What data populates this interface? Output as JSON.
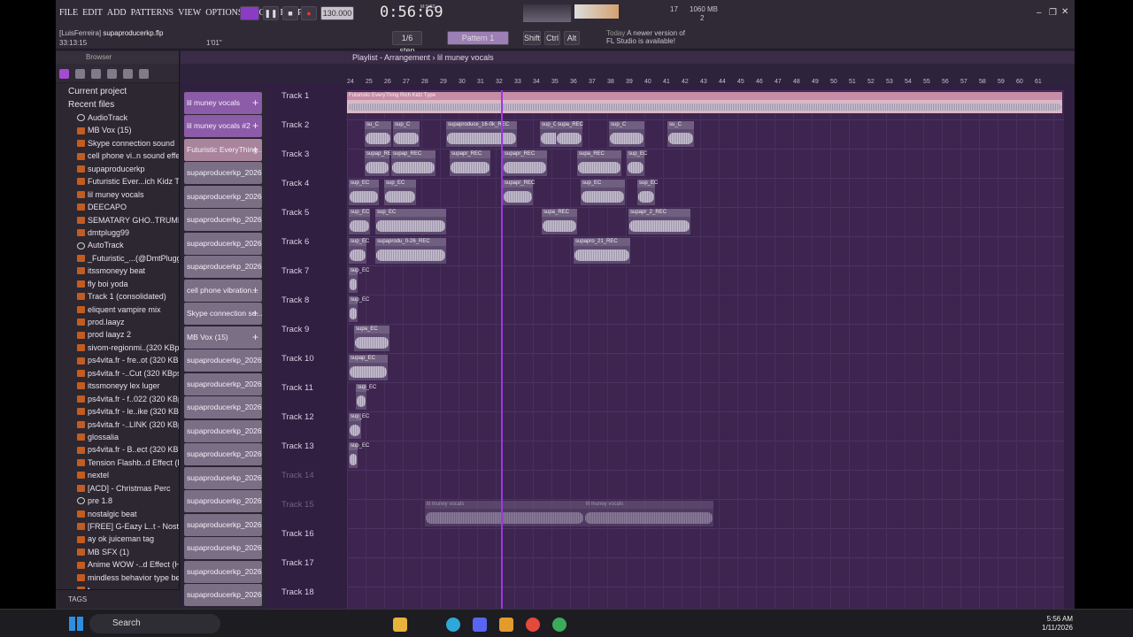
{
  "menu": [
    "FILE",
    "EDIT",
    "ADD",
    "PATTERNS",
    "VIEW",
    "OPTIONS",
    "TOOLS",
    "HELP"
  ],
  "project": {
    "user": "[LuisFerreira]",
    "file": "supaproducerkp.flp",
    "time_total": "33:13:15",
    "zoom": "1'01\""
  },
  "transport": {
    "tempo": "130.000",
    "time": "0:56:69",
    "time_units": "M:S:CS",
    "pattern": "Pattern 1",
    "step": "1/6 step",
    "cpu": "17",
    "memory": "1060 MB",
    "voices": "2"
  },
  "keys": {
    "shift": "Shift",
    "ctrl": "Ctrl",
    "alt": "Alt"
  },
  "news": {
    "label": "Today",
    "text": "A newer version of FL Studio is available!"
  },
  "browser": {
    "title": "Browser",
    "current": "Current project",
    "recent": "Recent files",
    "items": [
      "AudioTrack",
      "MB Vox (15)",
      "Skype connection sound",
      "cell phone vi..n sound effect",
      "supaproducerkp",
      "Futuristic Ever...ich Kidz Type",
      "lil muney vocals",
      "DEECAPO",
      "SEMATARY GHO..TRUMENTAL",
      "dmtplugg99",
      "AutoTrack",
      "_Futuristic_...(@DmtPlugg99)",
      "itssmoneyy beat",
      "fly boi yoda",
      "Track 1 (consolidated)",
      "eliquent vampire mix",
      "prod.laayz",
      "prod laayz 2",
      "sivom-regionmi..(320 KBps)",
      "ps4vita.fr - fre..ot (320 KBps)",
      "ps4vita.fr -..Cut (320 KBps)",
      "itssmoneyy lex luger",
      "ps4vita.fr - f..022 (320 KBps)",
      "ps4vita.fr - le..ike (320 KBps)",
      "ps4vita.fr -..LINK (320 KBps)",
      "glossalia",
      "ps4vita.fr - B..ect (320 KBps)",
      "Tension Flashb..d Effect (HD)",
      "nextel",
      "[ACD] - Christmas Perc",
      "pre 1.8",
      "nostalgic beat",
      "[FREE] G-Eazy L..t - Nostalgic",
      "ay ok juiceman tag",
      "MB SFX (1)",
      "Anime WOW -..d Effect (HD)",
      "mindless behavior type beat",
      "t..."
    ],
    "tags": "TAGS"
  },
  "playlist": {
    "title": "Playlist - Arrangement",
    "pattern_name": "lil muney vocals",
    "ruler": [
      "24",
      "25",
      "26",
      "27",
      "28",
      "29",
      "30",
      "31",
      "32",
      "33",
      "34",
      "35",
      "36",
      "37",
      "38",
      "39",
      "40",
      "41",
      "42",
      "43",
      "44",
      "45",
      "46",
      "47",
      "48",
      "49",
      "50",
      "51",
      "52",
      "53",
      "54",
      "55",
      "56",
      "57",
      "58",
      "59",
      "60",
      "61"
    ],
    "patterns": [
      "lil muney vocals",
      "lil muney vocals #2",
      "Futuristic EveryThing...",
      "supaproducerkp_2026-0...",
      "supaproducerkp_2026-0...",
      "supaproducerkp_2026-0...",
      "supaproducerkp_2026-0...",
      "supaproducerkp_2026-0...",
      "cell phone vibration...",
      "Skype connection so...",
      "MB Vox (15)",
      "supaproducerkp_2026-0...",
      "supaproducerkp_2026-0...",
      "supaproducerkp_2026-0...",
      "supaproducerkp_2026-0...",
      "supaproducerkp_2026-0...",
      "supaproducerkp_2026-0...",
      "supaproducerkp_2026-0...",
      "supaproducerkp_2026-0...",
      "supaproducerkp_2026-0...",
      "supaproducerkp_2026-0...",
      "supaproducerkp_2026-0..."
    ],
    "tracks": [
      "Track 1",
      "Track 2",
      "Track 3",
      "Track 4",
      "Track 5",
      "Track 6",
      "Track 7",
      "Track 8",
      "Track 9",
      "Track 10",
      "Track 11",
      "Track 12",
      "Track 13",
      "Track 14",
      "Track 15",
      "Track 16",
      "Track 17",
      "Track 18"
    ],
    "clip_labels": [
      "Futuristic EveryThing Rich Kidz Type",
      "su_C",
      "sup_C",
      "supaproduce_16-0k_REC",
      "sup_C",
      "supa_REC",
      "sup_C",
      "su_C",
      "supap_REC",
      "supap_REC",
      "supapr_REC",
      "supapr_REC",
      "supa_REC",
      "sup_EC",
      "sup_EC",
      "sup_EC",
      "supapr_REC",
      "sup_EC",
      "sup_EC",
      "sup_EC",
      "supa_REC",
      "supapr_2_REC",
      "supaprodu_0-26_REC",
      "supapro_21_REC",
      "supa_EC",
      "supap_EC",
      "lil muney vocals",
      "lil muney vocals"
    ]
  },
  "taskbar": {
    "search": "Search",
    "time": "5:56 AM",
    "date": "1/11/2026"
  }
}
